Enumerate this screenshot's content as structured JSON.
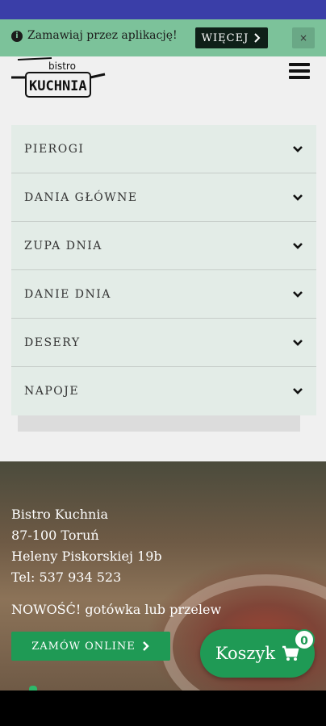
{
  "banner": {
    "info_icon": "info-circle-icon",
    "text": "Zamawiaj przez aplikację!",
    "more_label": "WIĘCEJ",
    "more_icon": "chevron-right-icon",
    "close_label": "×"
  },
  "header": {
    "logo_small": "bistro",
    "logo_big": "KUCHNIA",
    "menu_icon": "hamburger-icon"
  },
  "menu": {
    "items": [
      {
        "label": "PIEROGI"
      },
      {
        "label": "DANIA GŁÓWNE"
      },
      {
        "label": "ZUPA DNIA"
      },
      {
        "label": "DANIE DNIA"
      },
      {
        "label": "DESERY"
      },
      {
        "label": "NAPOJE"
      }
    ]
  },
  "footer": {
    "name": "Bistro Kuchnia",
    "city": "87-100 Toruń",
    "street": "Heleny Piskorskiej 19b",
    "phone": "Tel: 537 934 523",
    "news": "NOWOŚĆ! gotówka lub przelew",
    "order_label": "ZAMÓW ONLINE",
    "order_icon": "chevron-right-icon"
  },
  "cart": {
    "label": "Koszyk",
    "icon": "shopping-cart-icon",
    "count": "0"
  },
  "colors": {
    "banner": "#7cc29a",
    "accent_green": "#1f9a55",
    "status_bar": "#3a3ea8",
    "menu_bg": "#e3ece7"
  }
}
